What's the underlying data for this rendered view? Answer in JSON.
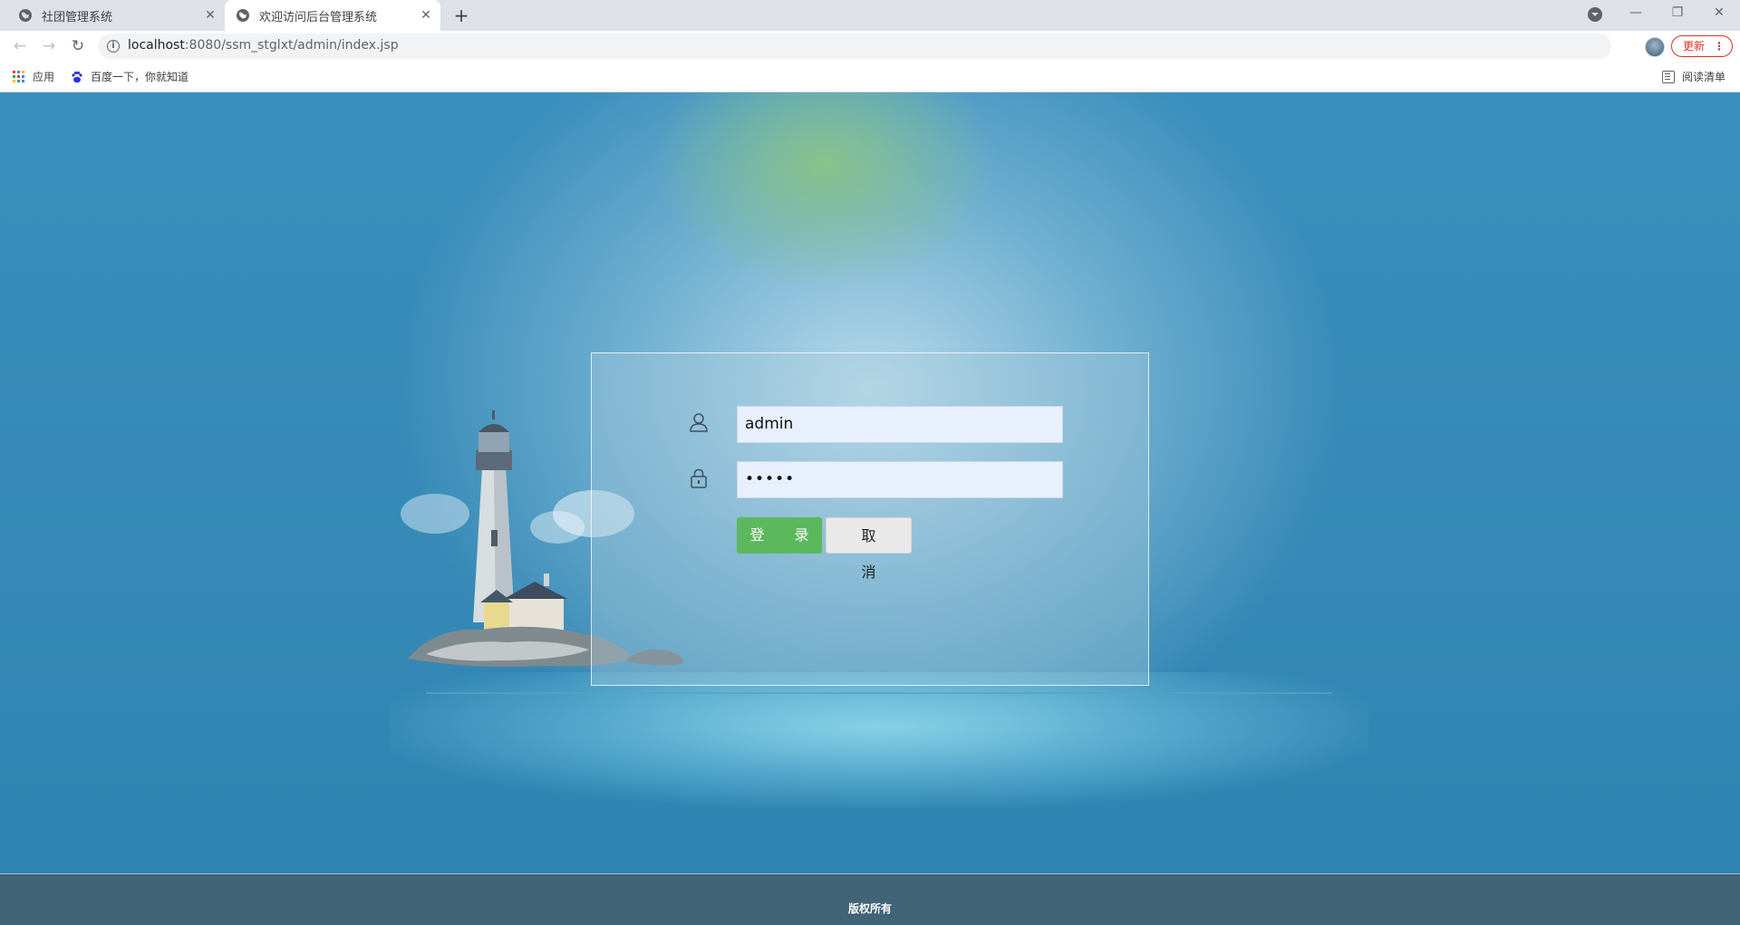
{
  "browser": {
    "tabs": [
      {
        "title": "社团管理系统",
        "active": false
      },
      {
        "title": "欢迎访问后台管理系统",
        "active": true
      }
    ],
    "url_host": "localhost",
    "url_rest": ":8080/ssm_stglxt/admin/index.jsp",
    "update_label": "更新",
    "bookmarks": [
      {
        "label": "应用",
        "icon": "apps-grid-icon"
      },
      {
        "label": "百度一下，你就知道",
        "icon": "baidu-paw-icon"
      }
    ],
    "reading_list_label": "阅读清单"
  },
  "login": {
    "username_value": "admin",
    "password_value": "•••••",
    "login_label": "登 录",
    "cancel_label": "取 消"
  },
  "footer": {
    "copyright": "版权所有"
  },
  "colors": {
    "background_blue": "#2f86b3",
    "login_green": "#5cb85c",
    "footer_bg": "#426477"
  }
}
